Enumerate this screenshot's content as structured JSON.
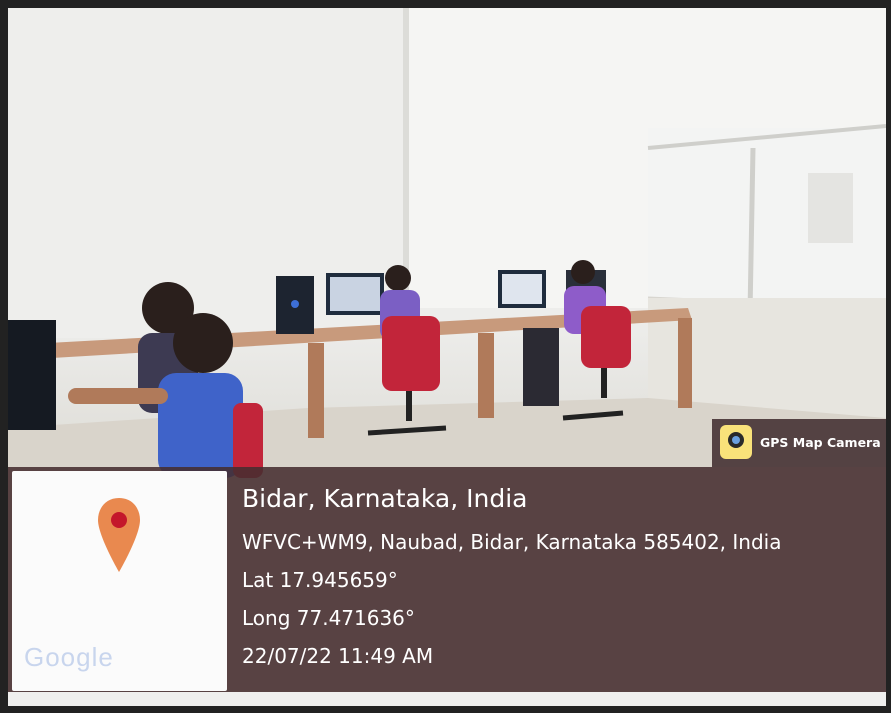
{
  "location": {
    "title": "Bidar, Karnataka, India",
    "address": "WFVC+WM9, Naubad, Bidar, Karnataka 585402, India",
    "latitude": "Lat 17.945659°",
    "longitude": "Long 77.471636°",
    "datetime": "22/07/22 11:49 AM"
  },
  "map_tile": {
    "brand": "Google",
    "pin_color": "#e9894f"
  },
  "app_badge": {
    "label": "GPS Map Camera",
    "icon": "camera-pin-icon"
  },
  "colors": {
    "overlay": "#462e30",
    "chair": "#c2253a",
    "monitor": "#1f2c3d"
  }
}
